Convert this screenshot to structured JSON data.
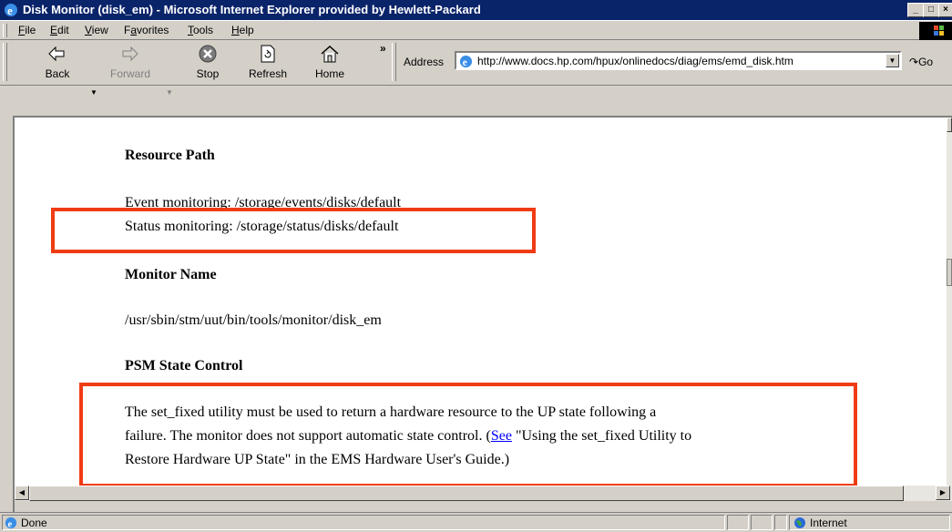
{
  "window": {
    "title": "Disk Monitor (disk_em) - Microsoft Internet Explorer provided by Hewlett-Packard"
  },
  "menu": [
    {
      "label": "File",
      "key": "F",
      "rest": "ile"
    },
    {
      "label": "Edit",
      "key": "E",
      "rest": "dit"
    },
    {
      "label": "View",
      "key": "V",
      "rest": "iew"
    },
    {
      "label": "Favorites",
      "key": "a",
      "rest": "vorites"
    },
    {
      "label": "Tools",
      "key": "T",
      "rest": "ools"
    },
    {
      "label": "Help",
      "key": "H",
      "rest": "elp"
    }
  ],
  "toolbar": {
    "back": "Back",
    "forward": "Forward",
    "stop": "Stop",
    "refresh": "Refresh",
    "home": "Home",
    "chevron": "»",
    "address_label": "Address",
    "address_url": "http://www.docs.hp.com/hpux/onlinedocs/diag/ems/emd_disk.htm",
    "go": "Go"
  },
  "document": {
    "resource_path_heading": "Resource Path",
    "event_monitoring": "Event monitoring: /storage/events/disks/default",
    "status_monitoring": "Status monitoring: /storage/status/disks/default",
    "monitor_name_heading": "Monitor Name",
    "monitor_path": "/usr/sbin/stm/uut/bin/tools/monitor/disk_em",
    "psm_heading": "PSM State Control",
    "psm_line1": "The set_fixed utility must be used to return a hardware resource to the UP state following a",
    "psm_line2_pre": "failure. The monitor does not support automatic state control. (",
    "psm_link": "See",
    "psm_line2_post": " \"Using the set_fixed Utility to",
    "psm_line3": "Restore Hardware UP State\" in the EMS Hardware User's Guide.)"
  },
  "status": {
    "text": "Done",
    "zone": "Internet"
  },
  "colors": {
    "highlight_box": "#f03c14",
    "title_bar": "#0a246a",
    "link": "#0000ff"
  }
}
